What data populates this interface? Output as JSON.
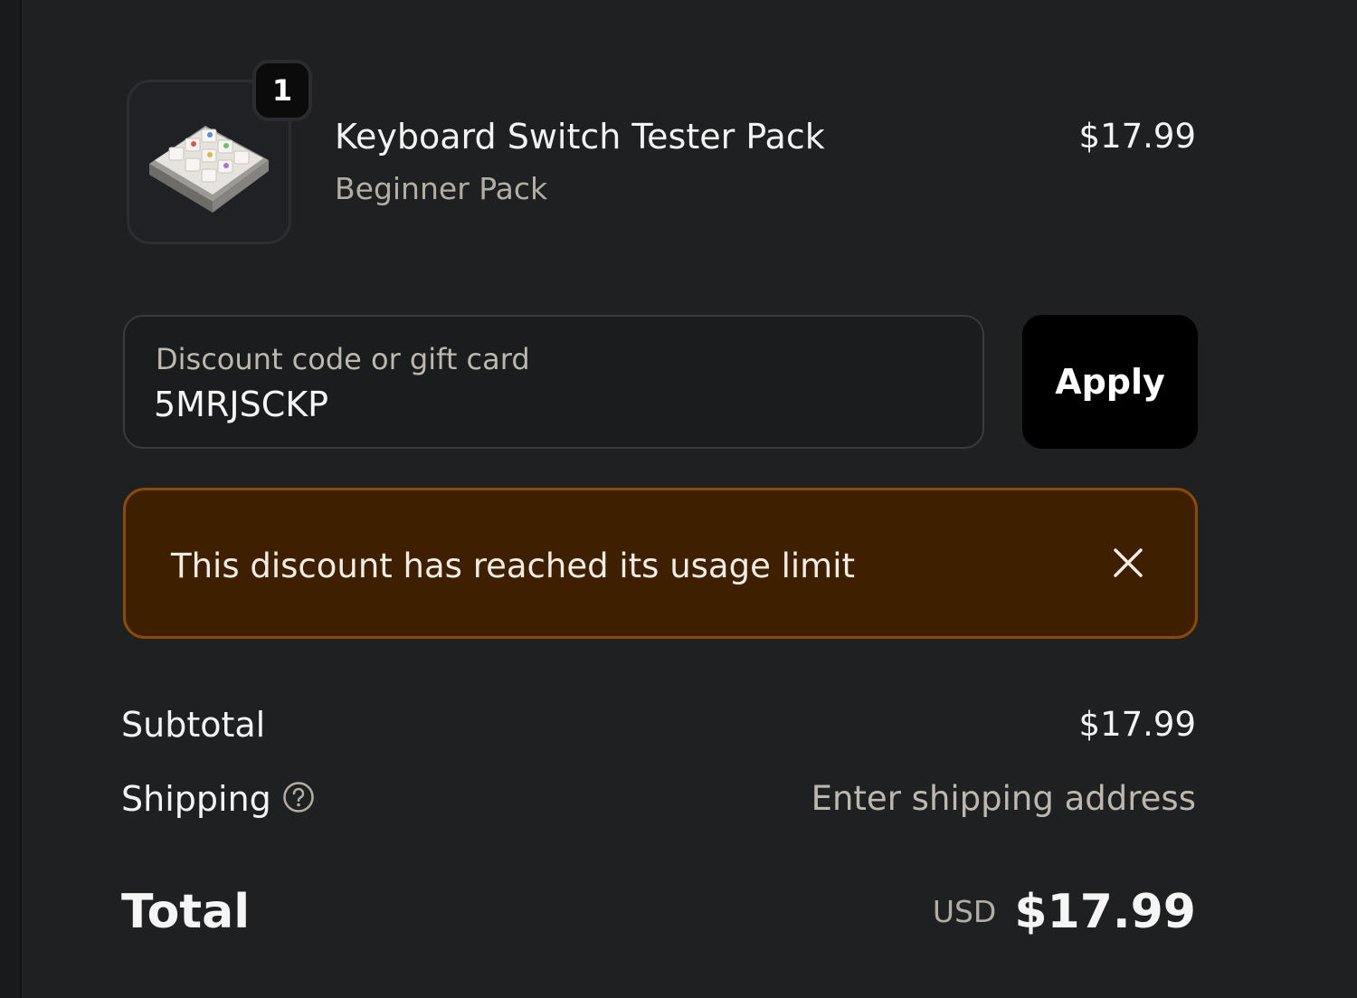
{
  "line_item": {
    "quantity": "1",
    "name": "Keyboard Switch Tester Pack",
    "variant": "Beginner Pack",
    "price": "$17.99",
    "image_icon": "keyboard-switch-tester-image"
  },
  "discount": {
    "label": "Discount code or gift card",
    "value": "5MRJSCKP",
    "apply_label": "Apply"
  },
  "error": {
    "message": "This discount has reached its usage limit",
    "close_icon": "close-icon"
  },
  "summary": {
    "subtotal_label": "Subtotal",
    "subtotal_value": "$17.99",
    "shipping_label": "Shipping",
    "shipping_help_icon": "help-circle-icon",
    "shipping_value": "Enter shipping address",
    "total_label": "Total",
    "currency": "USD",
    "total_value": "$17.99"
  },
  "colors": {
    "background": "#1f2022",
    "error_background": "#3e2000",
    "error_border": "#8c4a08",
    "apply_button": "#000000",
    "muted_text": "#b3aea4"
  }
}
